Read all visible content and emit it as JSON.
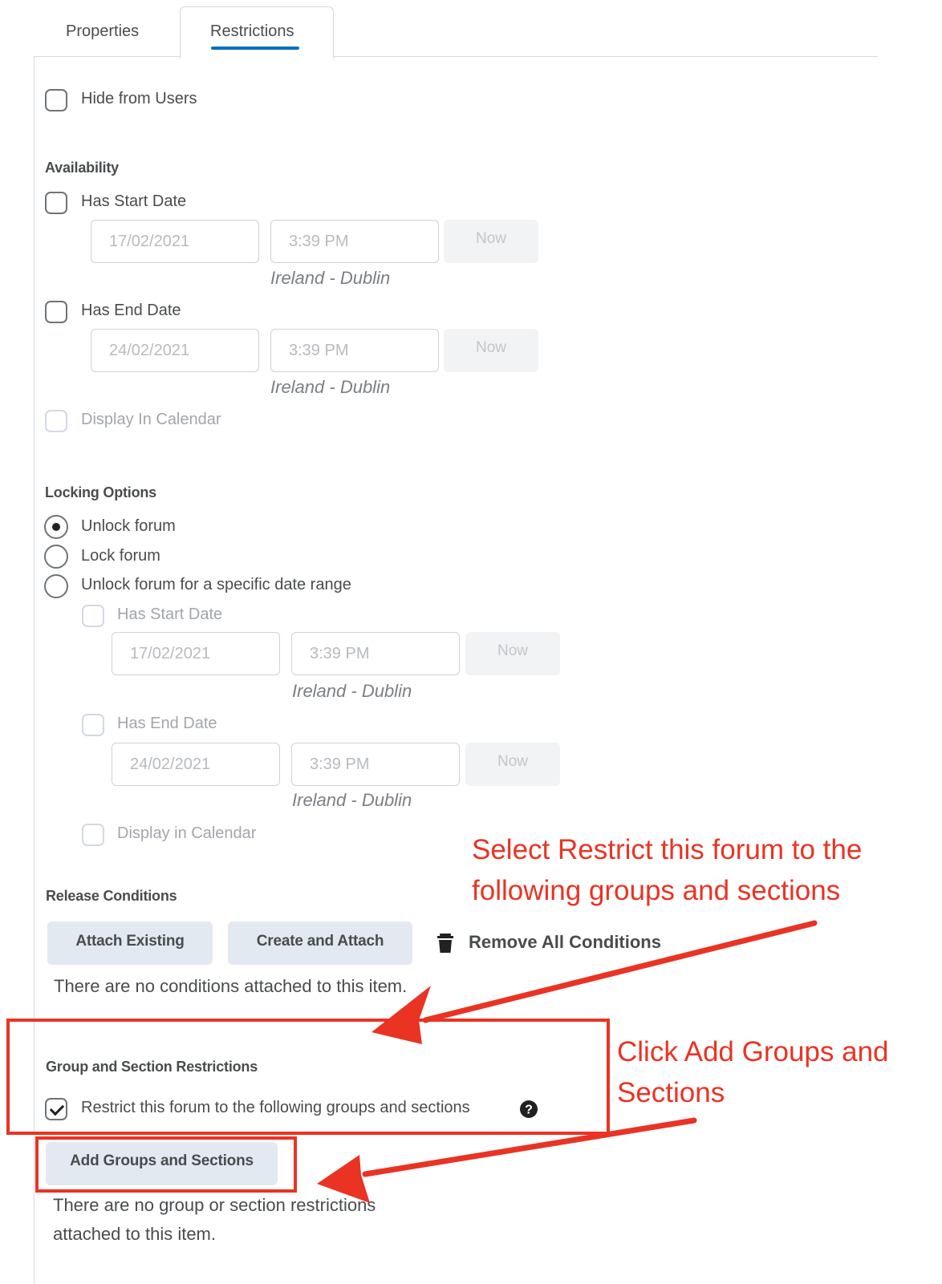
{
  "tabs": [
    {
      "label": "Properties",
      "active": false
    },
    {
      "label": "Restrictions",
      "active": true
    }
  ],
  "visibility": {
    "hide_from_users": {
      "label": "Hide from Users",
      "checked": false
    }
  },
  "availability": {
    "heading": "Availability",
    "start": {
      "label": "Has Start Date",
      "checked": false,
      "date": "17/02/2021",
      "time": "3:39 PM",
      "now": "Now",
      "timezone": "Ireland - Dublin"
    },
    "end": {
      "label": "Has End Date",
      "checked": false,
      "date": "24/02/2021",
      "time": "3:39 PM",
      "now": "Now",
      "timezone": "Ireland - Dublin"
    },
    "display_in_calendar": {
      "label": "Display In Calendar",
      "checked": false,
      "disabled": true
    }
  },
  "locking": {
    "heading": "Locking Options",
    "options": [
      {
        "label": "Unlock forum",
        "selected": true
      },
      {
        "label": "Lock forum",
        "selected": false
      },
      {
        "label": "Unlock forum for a specific date range",
        "selected": false
      }
    ],
    "start": {
      "label": "Has Start Date",
      "checked": false,
      "date": "17/02/2021",
      "time": "3:39 PM",
      "now": "Now",
      "timezone": "Ireland - Dublin"
    },
    "end": {
      "label": "Has End Date",
      "checked": false,
      "date": "24/02/2021",
      "time": "3:39 PM",
      "now": "Now",
      "timezone": "Ireland - Dublin"
    },
    "display_in_calendar": {
      "label": "Display in Calendar",
      "checked": false,
      "disabled": true
    }
  },
  "release_conditions": {
    "heading": "Release Conditions",
    "attach_existing": "Attach Existing",
    "create_and_attach": "Create and Attach",
    "remove_all": "Remove All Conditions",
    "empty_message": "There are no conditions attached to this item."
  },
  "group_restrictions": {
    "heading": "Group and Section Restrictions",
    "restrict": {
      "label": "Restrict this forum to the following groups and sections",
      "checked": true
    },
    "add_button": "Add Groups and Sections",
    "empty_message_line1": "There are no group or section restrictions",
    "empty_message_line2": "attached to this item."
  },
  "annotations": {
    "note1_line1": "Select Restrict this forum to the",
    "note1_line2": "following groups and sections",
    "note2_line1": "Click Add Groups and",
    "note2_line2": "Sections",
    "color": "#ea3323"
  },
  "icons": {
    "trash": "trash-icon",
    "help": "help-icon",
    "arrow": "arrow-annotation"
  }
}
